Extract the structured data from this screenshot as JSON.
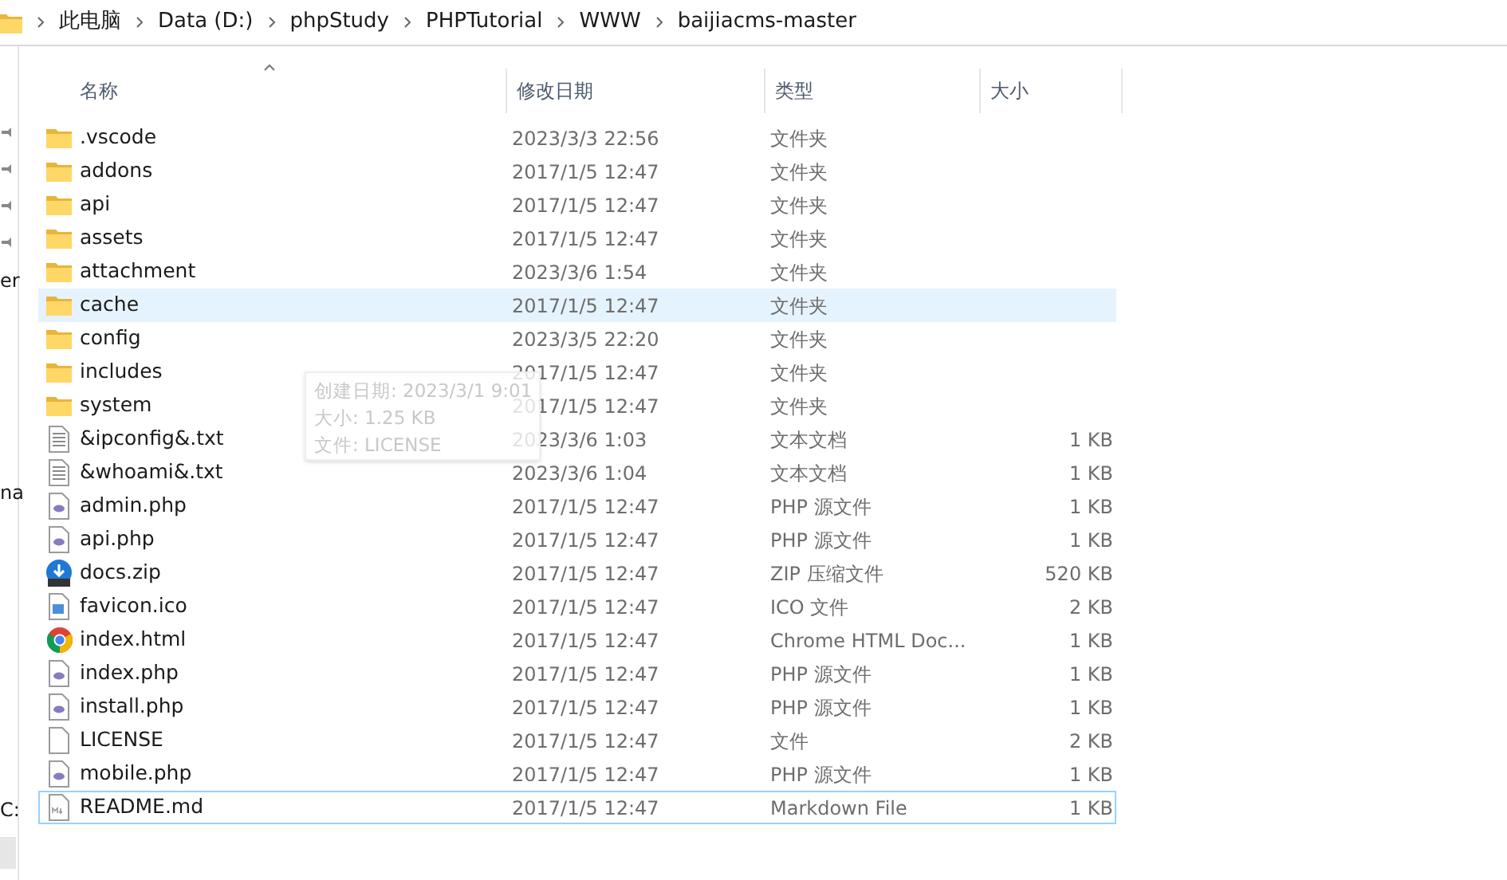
{
  "breadcrumb": [
    "此电脑",
    "Data (D:)",
    "phpStudy",
    "PHPTutorial",
    "WWW",
    "baijiacms-master"
  ],
  "nav_pane": {
    "labels": [
      "er",
      "na",
      "C:"
    ]
  },
  "columns": [
    {
      "label": "名称",
      "sorted": true
    },
    {
      "label": "修改日期",
      "sorted": false
    },
    {
      "label": "类型",
      "sorted": false
    },
    {
      "label": "大小",
      "sorted": false
    }
  ],
  "rows": [
    {
      "kind": "folder",
      "name": ".vscode",
      "date": "2023/3/3 22:56",
      "type": "文件夹",
      "hovered": false,
      "focused": false
    },
    {
      "kind": "folder",
      "name": "addons",
      "date": "2017/1/5 12:47",
      "type": "文件夹",
      "hovered": false,
      "focused": false
    },
    {
      "kind": "folder",
      "name": "api",
      "date": "2017/1/5 12:47",
      "type": "文件夹",
      "hovered": false,
      "focused": false
    },
    {
      "kind": "folder",
      "name": "assets",
      "date": "2017/1/5 12:47",
      "type": "文件夹",
      "hovered": false,
      "focused": false
    },
    {
      "kind": "folder",
      "name": "attachment",
      "date": "2023/3/6 1:54",
      "type": "文件夹",
      "hovered": false,
      "focused": false
    },
    {
      "kind": "folder",
      "name": "cache",
      "date": "2017/1/5 12:47",
      "type": "文件夹",
      "hovered": true,
      "focused": false
    },
    {
      "kind": "folder",
      "name": "config",
      "date": "2023/3/5 22:20",
      "type": "文件夹",
      "hovered": false,
      "focused": false
    },
    {
      "kind": "folder",
      "name": "includes",
      "date": "2017/1/5 12:47",
      "type": "文件夹",
      "hovered": false,
      "focused": false
    },
    {
      "kind": "folder",
      "name": "system",
      "date": "2017/1/5 12:47",
      "type": "文件夹",
      "hovered": false,
      "focused": false
    },
    {
      "kind": "text",
      "name": "&ipconfig&.txt",
      "date": "2023/3/6 1:03",
      "type": "文本文档",
      "size": "1 KB",
      "hovered": false,
      "focused": false
    },
    {
      "kind": "text",
      "name": "&whoami&.txt",
      "date": "2023/3/6 1:04",
      "type": "文本文档",
      "size": "1 KB",
      "hovered": false,
      "focused": false
    },
    {
      "kind": "php",
      "name": "admin.php",
      "date": "2017/1/5 12:47",
      "type": "PHP 源文件",
      "size": "1 KB",
      "hovered": false,
      "focused": false
    },
    {
      "kind": "php",
      "name": "api.php",
      "date": "2017/1/5 12:47",
      "type": "PHP 源文件",
      "size": "1 KB",
      "hovered": false,
      "focused": false
    },
    {
      "kind": "zip",
      "name": "docs.zip",
      "date": "2017/1/5 12:47",
      "type": "ZIP 压缩文件",
      "size": "520 KB",
      "hovered": false,
      "focused": false
    },
    {
      "kind": "image",
      "name": "favicon.ico",
      "date": "2017/1/5 12:47",
      "type": "ICO 文件",
      "size": "2 KB",
      "hovered": false,
      "focused": false
    },
    {
      "kind": "browser",
      "name": "index.html",
      "date": "2017/1/5 12:47",
      "type": "Chrome HTML Doc...",
      "size": "1 KB",
      "hovered": false,
      "focused": false
    },
    {
      "kind": "php",
      "name": "index.php",
      "date": "2017/1/5 12:47",
      "type": "PHP 源文件",
      "size": "1 KB",
      "hovered": false,
      "focused": false
    },
    {
      "kind": "php",
      "name": "install.php",
      "date": "2017/1/5 12:47",
      "type": "PHP 源文件",
      "size": "1 KB",
      "hovered": false,
      "focused": false
    },
    {
      "kind": "blank",
      "name": "LICENSE",
      "date": "2017/1/5 12:47",
      "type": "文件",
      "size": "2 KB",
      "hovered": false,
      "focused": false
    },
    {
      "kind": "php",
      "name": "mobile.php",
      "date": "2017/1/5 12:47",
      "type": "PHP 源文件",
      "size": "1 KB",
      "hovered": false,
      "focused": false
    },
    {
      "kind": "markdown",
      "name": "README.md",
      "date": "2017/1/5 12:47",
      "type": "Markdown File",
      "size": "1 KB",
      "hovered": false,
      "focused": true
    }
  ],
  "tooltip": [
    "创建日期: 2023/3/1 9:01",
    "大小: 1.25 KB",
    "文件: LICENSE"
  ]
}
